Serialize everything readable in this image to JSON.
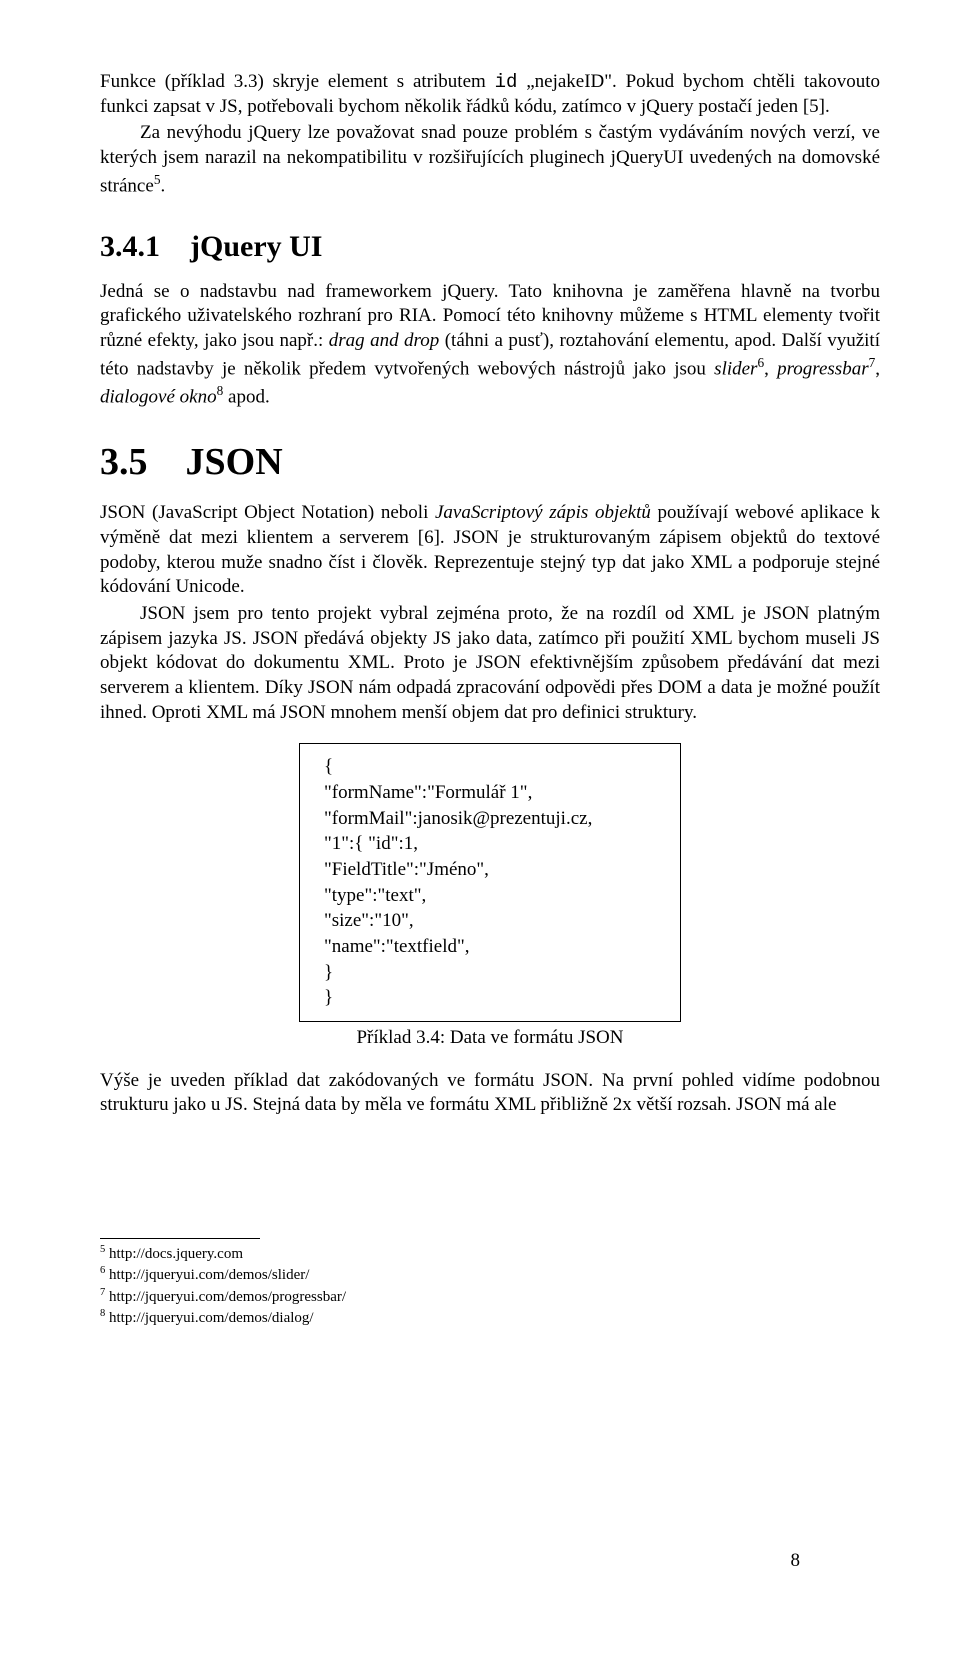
{
  "p1": {
    "lead": "Funkce (příklad 3.3) skryje element s atributem ",
    "code": "id",
    "mid": " „nejakeID\". Pokud bychom chtěli takovouto funkci zapsat v JS, potřebovali bychom několik řádků kódu, zatímco v jQuery postačí jeden [5]."
  },
  "p2": "Za nevýhodu jQuery lze považovat snad pouze problém s častým vydáváním nových verzí, ve kterých jsem narazil na nekompatibilitu v rozšiřujících pluginech jQueryUI uvedených na domovské stránce",
  "p2_sup": "5",
  "p2_end": ".",
  "h341": "3.4.1 jQuery UI",
  "p3a": "Jedná se o nadstavbu nad frameworkem jQuery. Tato knihovna je zaměřena hlavně na tvorbu grafického uživatelského rozhraní pro RIA. Pomocí této knihovny můžeme s HTML elementy tvořit různé efekty, jako jsou např.: ",
  "p3b": "drag and drop",
  "p3c": " (táhni a pusť), roztahování elementu, apod. Další využití této nadstavby je několik předem vytvořených webových nástrojů jako jsou ",
  "p3d": "slider",
  "p3d_sup": "6",
  "p3e": ", ",
  "p3f": "progressbar",
  "p3f_sup": "7",
  "p3g": ", ",
  "p3h": "dialogové okno",
  "p3h_sup": "8",
  "p3i": " apod.",
  "h35": "3.5 JSON",
  "p4a": "JSON (JavaScript Object Notation) neboli ",
  "p4b": "JavaScriptový zápis objektů",
  "p4c": " používají webové aplikace k výměně dat mezi klientem a serverem [6]. JSON je strukturovaným zápisem objektů do textové podoby, kterou muže snadno číst i člověk. Reprezentuje stejný typ dat jako XML a podporuje stejné kódování Unicode.",
  "p5": "JSON jsem pro tento projekt vybral zejména proto, že na rozdíl od XML je JSON platným zápisem jazyka JS. JSON předává objekty JS jako data, zatímco při použití XML bychom museli JS objekt kódovat do dokumentu XML. Proto je JSON efektivnějším způsobem předávání dat mezi serverem a klientem. Díky JSON nám odpadá zpracování odpovědi přes DOM a data je možné použít ihned. Oproti XML má JSON mnohem menší objem dat pro definici struktury.",
  "code": {
    "l1": "{",
    "l2": "  \"formName\":\"Formulář 1\",",
    "l3": "  \"formMail\":janosik@prezentuji.cz,",
    "l4": "  \"1\":{     \"id\":1,",
    "l5": "        \"FieldTitle\":\"Jméno\",",
    "l6": "        \"type\":\"text\",",
    "l7": "        \"size\":\"10\",",
    "l8": "        \"name\":\"textfield\",",
    "l9": "        }",
    "l10": "}"
  },
  "caption": "Příklad 3.4: Data ve formátu JSON",
  "p6": "Výše je uveden příklad dat zakódovaných ve formátu JSON. Na první pohled vidíme podobnou strukturu jako u JS. Stejná data by měla ve formátu XML přibližně 2x větší rozsah. JSON má ale",
  "fn5": "5 http://docs.jquery.com",
  "fn6": "6 http://jqueryui.com/demos/slider/",
  "fn7": "7 http://jqueryui.com/demos/progressbar/",
  "fn8": "8 http://jqueryui.com/demos/dialog/",
  "pagenum": "8"
}
